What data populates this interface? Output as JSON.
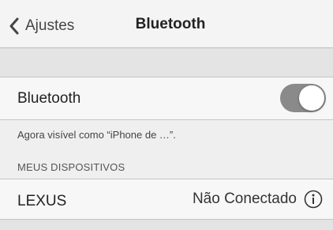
{
  "nav": {
    "back_label": "Ajustes",
    "title": "Bluetooth",
    "back_icon": "chevron-left-icon"
  },
  "bluetooth": {
    "label": "Bluetooth",
    "enabled": true,
    "visibility_text": "Agora visível como “iPhone de …”."
  },
  "devices": {
    "section_header": "MEUS DISPOSITIVOS",
    "items": [
      {
        "name": "LEXUS",
        "status": "Não Conectado",
        "info_icon": "info-icon"
      }
    ]
  },
  "colors": {
    "toggle_track": "#8a8a8a",
    "nav_background": "#f4f4f4",
    "group_background": "#e4e4e4"
  }
}
